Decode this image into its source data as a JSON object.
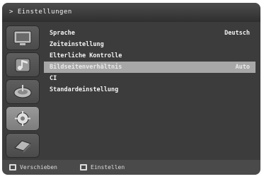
{
  "title_bar": {
    "title": "> Einstellungen"
  },
  "sidebar": {
    "icons": [
      {
        "name": "tv-icon"
      },
      {
        "name": "music-icon"
      },
      {
        "name": "satellite-icon"
      },
      {
        "name": "settings-icon"
      },
      {
        "name": "module-icon"
      }
    ]
  },
  "menu": {
    "items": [
      {
        "label": "Sprache",
        "value": "Deutsch"
      },
      {
        "label": "Zeiteinstellung",
        "value": ""
      },
      {
        "label": "Elterliche Kontrolle",
        "value": ""
      },
      {
        "label": "Bildseitenverhältnis",
        "value": "Auto"
      },
      {
        "label": "CI",
        "value": ""
      },
      {
        "label": "Standardeinstellung",
        "value": ""
      }
    ],
    "selected_index": 3
  },
  "footer": {
    "exit_label": "Verschieben",
    "enter_label": "Einstellen"
  }
}
